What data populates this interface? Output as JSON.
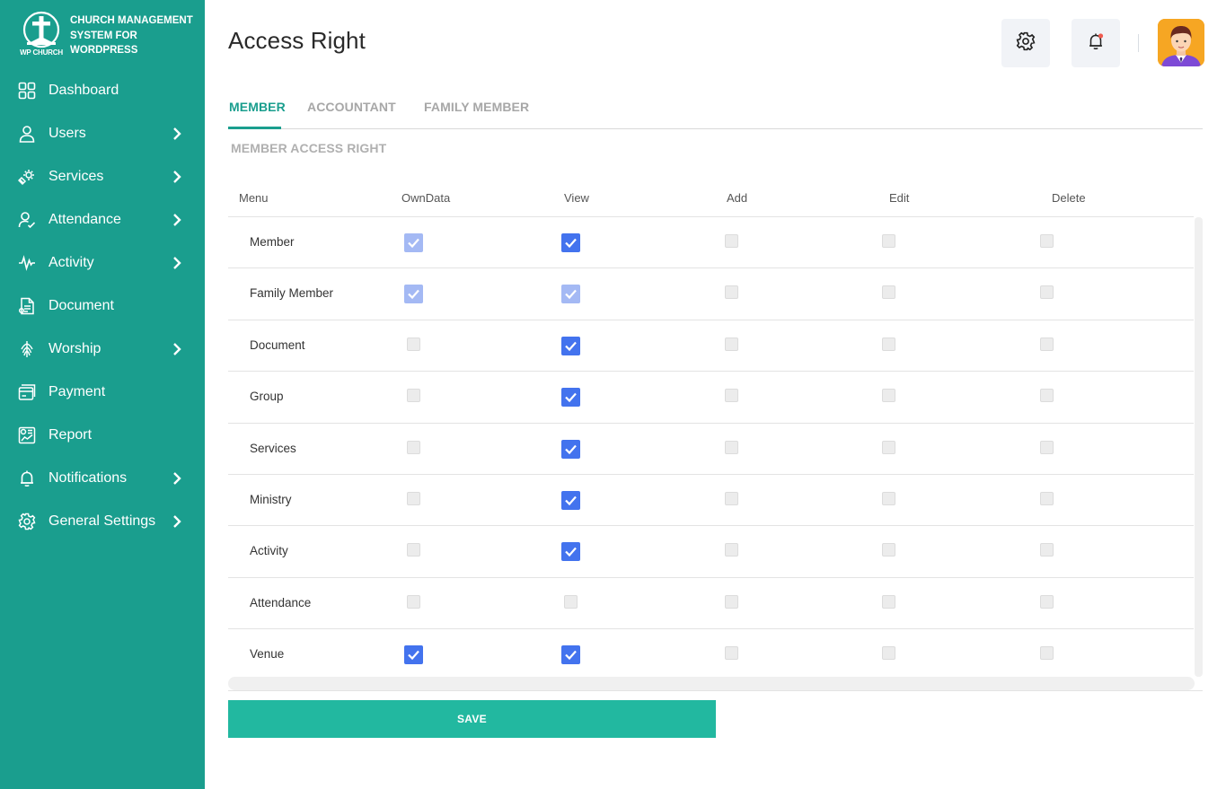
{
  "brand": {
    "logo_text": "WP CHURCH",
    "title": "CHURCH MANAGEMENT SYSTEM FOR WORDPRESS"
  },
  "sidebar": {
    "items": [
      {
        "label": "Dashboard",
        "icon": "dashboard-icon",
        "has_submenu": false
      },
      {
        "label": "Users",
        "icon": "user-icon",
        "has_submenu": true
      },
      {
        "label": "Services",
        "icon": "services-icon",
        "has_submenu": true
      },
      {
        "label": "Attendance",
        "icon": "attendance-icon",
        "has_submenu": true
      },
      {
        "label": "Activity",
        "icon": "activity-icon",
        "has_submenu": true
      },
      {
        "label": "Document",
        "icon": "document-icon",
        "has_submenu": false
      },
      {
        "label": "Worship",
        "icon": "worship-icon",
        "has_submenu": true
      },
      {
        "label": "Payment",
        "icon": "payment-icon",
        "has_submenu": false
      },
      {
        "label": "Report",
        "icon": "report-icon",
        "has_submenu": false
      },
      {
        "label": "Notifications",
        "icon": "bell-icon",
        "has_submenu": true
      },
      {
        "label": "General Settings",
        "icon": "gear-icon",
        "has_submenu": true
      }
    ]
  },
  "header": {
    "title": "Access Right",
    "settings_icon": "gear-icon",
    "notification_icon": "bell-icon",
    "has_unread_notification": true
  },
  "tabs": [
    {
      "label": "MEMBER",
      "active": true
    },
    {
      "label": "ACCOUNTANT",
      "active": false
    },
    {
      "label": "FAMILY MEMBER",
      "active": false
    }
  ],
  "section_title": "MEMBER ACCESS RIGHT",
  "table": {
    "columns": [
      "Menu",
      "OwnData",
      "View",
      "Add",
      "Edit",
      "Delete"
    ],
    "rows": [
      {
        "menu": "Member",
        "perms": [
          "checked-faded",
          "checked",
          "unchecked",
          "unchecked",
          "unchecked"
        ]
      },
      {
        "menu": "Family Member",
        "perms": [
          "checked-faded",
          "checked-faded",
          "unchecked",
          "unchecked",
          "unchecked"
        ]
      },
      {
        "menu": "Document",
        "perms": [
          "unchecked",
          "checked",
          "unchecked",
          "unchecked",
          "unchecked"
        ]
      },
      {
        "menu": "Group",
        "perms": [
          "unchecked",
          "checked",
          "unchecked",
          "unchecked",
          "unchecked"
        ]
      },
      {
        "menu": "Services",
        "perms": [
          "unchecked",
          "checked",
          "unchecked",
          "unchecked",
          "unchecked"
        ]
      },
      {
        "menu": "Ministry",
        "perms": [
          "unchecked",
          "checked",
          "unchecked",
          "unchecked",
          "unchecked"
        ]
      },
      {
        "menu": "Activity",
        "perms": [
          "unchecked",
          "checked",
          "unchecked",
          "unchecked",
          "unchecked"
        ]
      },
      {
        "menu": "Attendance",
        "perms": [
          "unchecked",
          "unchecked",
          "unchecked",
          "unchecked",
          "unchecked"
        ]
      },
      {
        "menu": "Venue",
        "perms": [
          "checked",
          "checked",
          "unchecked",
          "unchecked",
          "unchecked"
        ]
      }
    ]
  },
  "save_label": "SAVE",
  "colors": {
    "sidebar": "#1a9e8e",
    "accent": "#1a9e8e",
    "save_button": "#22b8a0",
    "checkbox_checked": "#4373ee",
    "checkbox_disabled_checked": "#a4b9f4"
  }
}
